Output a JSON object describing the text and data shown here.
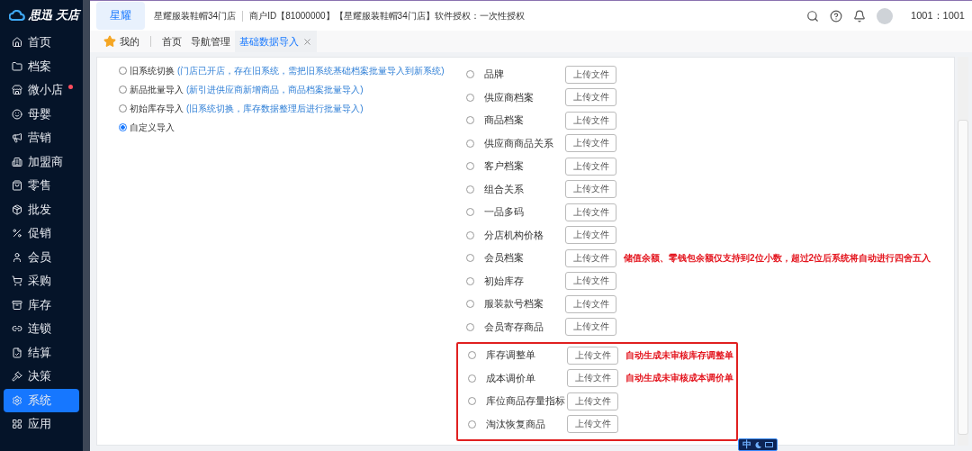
{
  "brand": {
    "name": "思迅",
    "product": "天店"
  },
  "sidebar": {
    "items": [
      {
        "label": "首页",
        "selected": false,
        "badge": false
      },
      {
        "label": "档案",
        "selected": false,
        "badge": false
      },
      {
        "label": "微小店",
        "selected": false,
        "badge": true
      },
      {
        "label": "母婴",
        "selected": false,
        "badge": false
      },
      {
        "label": "营销",
        "selected": false,
        "badge": false
      },
      {
        "label": "加盟商",
        "selected": false,
        "badge": false
      },
      {
        "label": "零售",
        "selected": false,
        "badge": false
      },
      {
        "label": "批发",
        "selected": false,
        "badge": false
      },
      {
        "label": "促销",
        "selected": false,
        "badge": false
      },
      {
        "label": "会员",
        "selected": false,
        "badge": false
      },
      {
        "label": "采购",
        "selected": false,
        "badge": false
      },
      {
        "label": "库存",
        "selected": false,
        "badge": false
      },
      {
        "label": "连锁",
        "selected": false,
        "badge": false
      },
      {
        "label": "结算",
        "selected": false,
        "badge": false
      },
      {
        "label": "决策",
        "selected": false,
        "badge": false
      },
      {
        "label": "系统",
        "selected": true,
        "badge": false
      },
      {
        "label": "应用",
        "selected": false,
        "badge": false
      }
    ]
  },
  "header": {
    "org_tab": "星耀",
    "store": "星耀服装鞋帽34门店",
    "merchant": "商户ID【81000000】【星耀服装鞋帽34门店】软件授权：一次性授权",
    "user": "1001：1001"
  },
  "tabs": [
    {
      "label": "我的",
      "kind": "favorites",
      "selected": false
    },
    {
      "label": "首页",
      "kind": "page",
      "selected": false
    },
    {
      "label": "导航管理",
      "kind": "page",
      "selected": false
    },
    {
      "label": "基础数据导入",
      "kind": "page",
      "selected": true
    }
  ],
  "import_modes": [
    {
      "label": "旧系统切换",
      "hint": "(门店已开店，存在旧系统，需把旧系统基础档案批量导入到新系统)",
      "selected": false
    },
    {
      "label": "新品批量导入",
      "hint": "(新引进供应商新增商品，商品档案批量导入)",
      "selected": false
    },
    {
      "label": "初始库存导入",
      "hint": "(旧系统切换，库存数据整理后进行批量导入)",
      "selected": false
    },
    {
      "label": "自定义导入",
      "selected": true
    }
  ],
  "import_groups": [
    {
      "kind": "plain",
      "items": [
        {
          "label": "品牌",
          "button": "上传文件",
          "selected": false
        },
        {
          "label": "供应商档案",
          "button": "上传文件",
          "selected": false
        },
        {
          "label": "商品档案",
          "button": "上传文件",
          "selected": false
        },
        {
          "label": "供应商商品关系",
          "button": "上传文件",
          "selected": false
        },
        {
          "label": "客户档案",
          "button": "上传文件",
          "selected": false
        },
        {
          "label": "组合关系",
          "button": "上传文件",
          "selected": false
        },
        {
          "label": "一品多码",
          "button": "上传文件",
          "selected": false
        },
        {
          "label": "分店机构价格",
          "button": "上传文件",
          "selected": false
        },
        {
          "label": "会员档案",
          "button": "上传文件",
          "selected": false,
          "note": "储值余额、零钱包余额仅支持到2位小数，超过2位后系统将自动进行四舍五入"
        },
        {
          "label": "初始库存",
          "button": "上传文件",
          "selected": false
        },
        {
          "label": "服装款号档案",
          "button": "上传文件",
          "selected": false
        },
        {
          "label": "会员寄存商品",
          "button": "上传文件",
          "selected": false
        }
      ]
    },
    {
      "kind": "highlighted",
      "items": [
        {
          "label": "库存调整单",
          "button": "上传文件",
          "selected": false,
          "note": "自动生成未审核库存调整单"
        },
        {
          "label": "成本调价单",
          "button": "上传文件",
          "selected": false,
          "note": "自动生成未审核成本调价单"
        },
        {
          "label": "库位商品存量指标",
          "button": "上传文件",
          "selected": false
        },
        {
          "label": "淘汰恢复商品",
          "button": "上传文件",
          "selected": false
        }
      ]
    }
  ],
  "ime_toolbar": {
    "mode": "中"
  }
}
